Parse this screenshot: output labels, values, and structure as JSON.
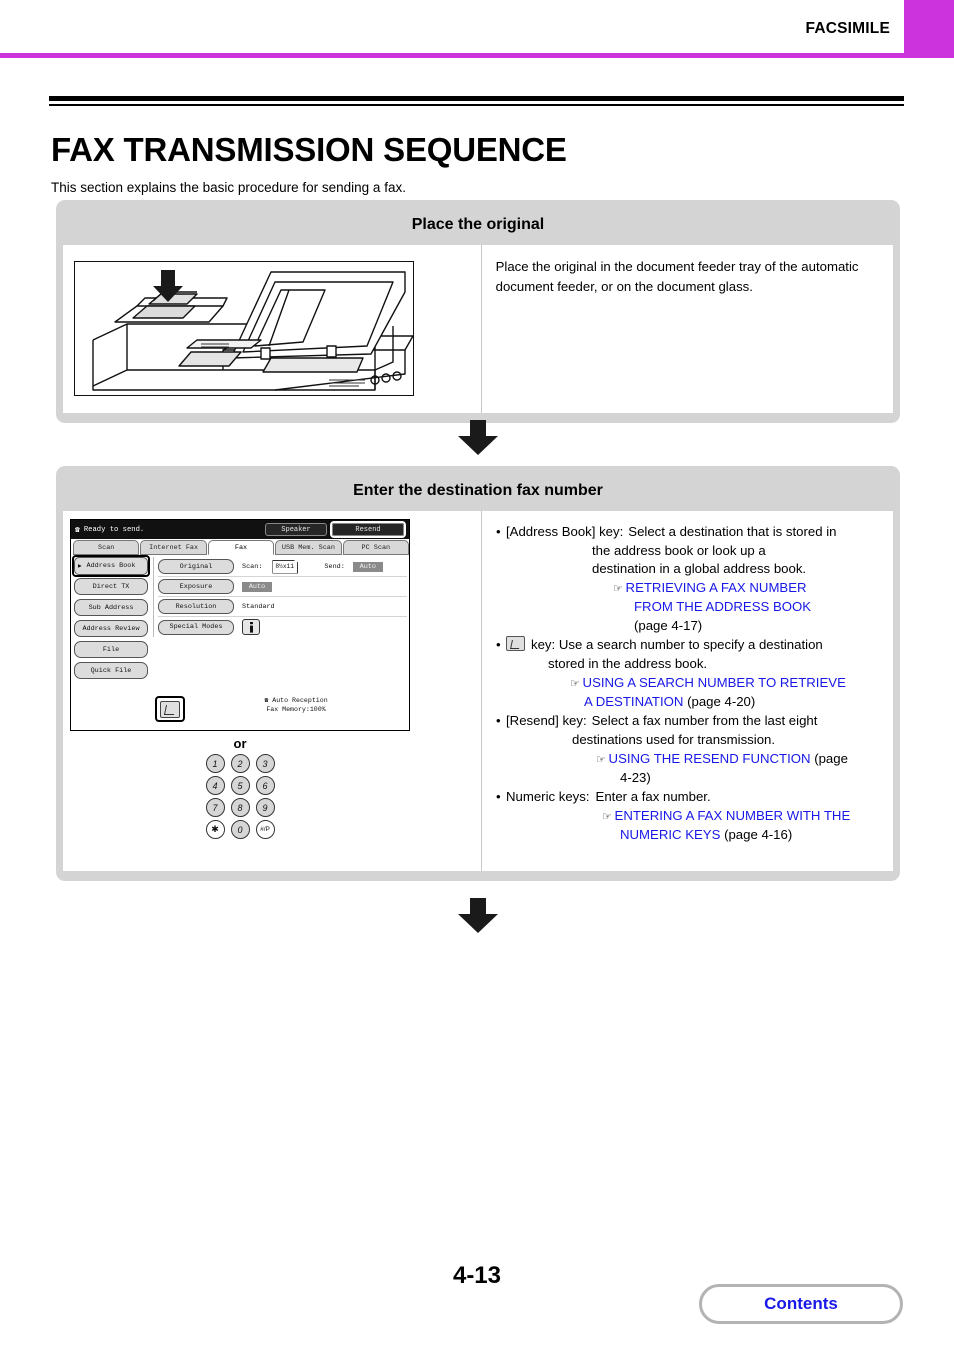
{
  "colors": {
    "accent": "#cc33dd",
    "link": "#1818e8",
    "panel_bg": "#d4d4d4"
  },
  "header": {
    "title": "FACSIMILE"
  },
  "page": {
    "title": "FAX TRANSMISSION SEQUENCE",
    "intro": "This section explains the basic procedure for sending a fax.",
    "number": "4-13",
    "contents_label": "Contents"
  },
  "steps": [
    {
      "heading": "Place the original",
      "description": "Place the original in the document feeder tray of the automatic document feeder, or on the document glass."
    },
    {
      "heading": "Enter the destination fax number"
    }
  ],
  "lcd": {
    "status": "Ready to send.",
    "speaker_label": "Speaker",
    "resend_label": "Resend",
    "tabs": [
      {
        "label": "Scan",
        "active": false
      },
      {
        "label": "Internet Fax",
        "active": false
      },
      {
        "label": "Fax",
        "active": true
      },
      {
        "label": "USB Mem. Scan",
        "active": false
      },
      {
        "label": "PC Scan",
        "active": false
      }
    ],
    "side_keys": [
      "Address Book",
      "Direct TX",
      "Sub Address",
      "Address Review",
      "File",
      "Quick File"
    ],
    "address_book_label": "Address Book",
    "rows": [
      {
        "key": "Original",
        "label": "Scan:",
        "paper_size": "8½x11",
        "label2": "Send:",
        "value2": "Auto"
      },
      {
        "key": "Exposure",
        "value": "Auto"
      },
      {
        "key": "Resolution",
        "value": "Standard"
      },
      {
        "key": "Special Modes",
        "value": ""
      }
    ],
    "info_glyph": "ⓘ",
    "reception_line1": "Auto Reception",
    "reception_line2": "Fax Memory:100%"
  },
  "or_label": "or",
  "keypad": {
    "rows": [
      [
        "1",
        "2",
        "3"
      ],
      [
        "4",
        "5",
        "6"
      ],
      [
        "7",
        "8",
        "9"
      ],
      [
        "✱",
        "0",
        "#/P"
      ]
    ]
  },
  "instructions": {
    "address_book": {
      "bullet_label": "[Address Book] key:",
      "line1": "Select a destination that is stored in",
      "line2": "the address book or look up a",
      "line3": "destination in a global address book.",
      "link": "RETRIEVING A FAX NUMBER",
      "link_cont": "FROM THE ADDRESS BOOK",
      "page_ref": "(page 4-17)"
    },
    "search_key": {
      "bullet_label": "key: Use a search number to specify a destination",
      "line2": "stored in the address book.",
      "link": "USING A SEARCH NUMBER TO RETRIEVE",
      "link_cont": "A DESTINATION",
      "page_ref": "(page 4-20)"
    },
    "resend": {
      "bullet_label": "[Resend] key:",
      "line1": "Select a fax number from the last eight",
      "line2": "destinations used for transmission.",
      "link": "USING THE RESEND FUNCTION",
      "page_ref_a": "(page",
      "page_ref_b": "4-23)"
    },
    "numeric": {
      "bullet_label": "Numeric keys:",
      "line1": "Enter a fax number.",
      "link": "ENTERING A FAX NUMBER WITH THE",
      "link_cont": "NUMERIC KEYS",
      "page_ref": "(page 4-16)"
    }
  }
}
